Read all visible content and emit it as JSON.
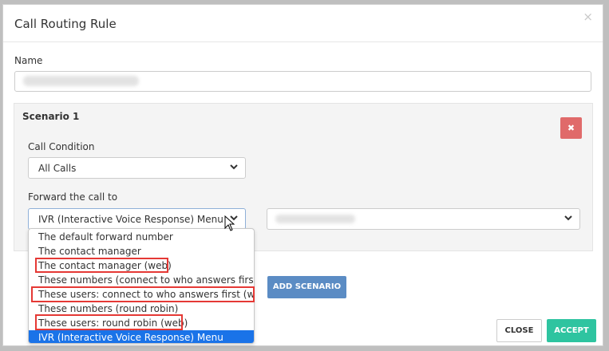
{
  "modal": {
    "title": "Call Routing Rule",
    "close_glyph": "×"
  },
  "name_field": {
    "label": "Name"
  },
  "scenario": {
    "title": "Scenario 1",
    "remove_glyph": "✖",
    "call_condition": {
      "label": "Call Condition",
      "value": "All Calls"
    },
    "forward": {
      "label": "Forward the call to",
      "value": "IVR (Interactive Voice Response) Menu"
    },
    "dropdown_options": [
      "The default forward number",
      "The contact manager",
      "The contact manager (web)",
      "These numbers (connect to who answers first)",
      "These users: connect to who answers first (web)",
      "These numbers (round robin)",
      "These users: round robin (web)",
      "IVR (Interactive Voice Response) Menu"
    ]
  },
  "buttons": {
    "add_scenario": "ADD SCENARIO",
    "close": "CLOSE",
    "accept": "ACCEPT"
  },
  "icons": {
    "close": "close-icon",
    "remove": "remove-icon",
    "chevron": "chevron-down-icon",
    "cursor": "mouse-cursor-icon"
  },
  "colors": {
    "remove": "#e06a6a",
    "add_scenario": "#5b8cc4",
    "accept": "#2ec4a0",
    "selected_option": "#1a73e8",
    "highlight": "#e53935"
  }
}
